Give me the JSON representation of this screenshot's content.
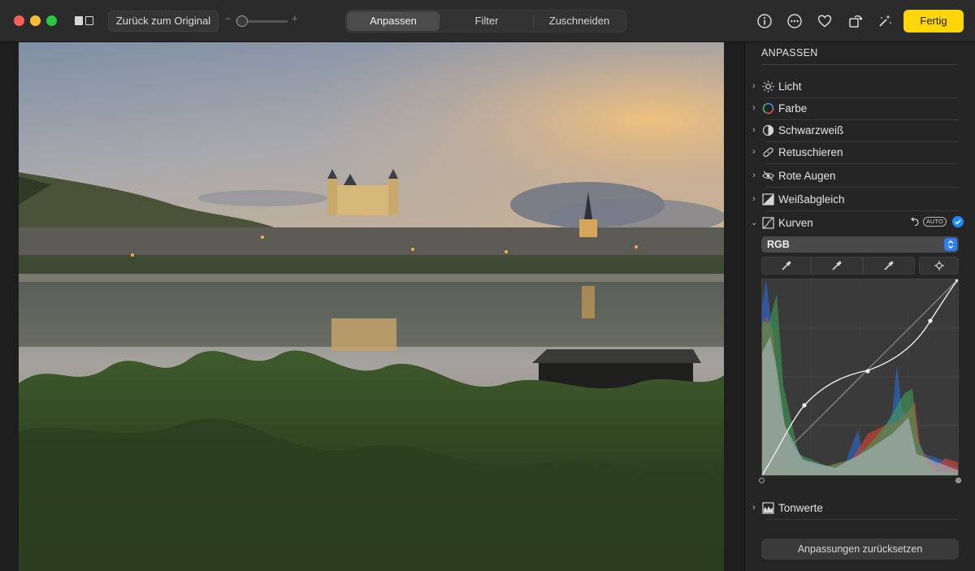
{
  "toolbar": {
    "revert_label": "Zurück zum Original",
    "zoom_minus": "−",
    "zoom_plus": "+",
    "zoom_level": 0.05,
    "tabs": [
      {
        "label": "Anpassen",
        "selected": true
      },
      {
        "label": "Filter",
        "selected": false
      },
      {
        "label": "Zuschneiden",
        "selected": false
      }
    ],
    "done_label": "Fertig",
    "icons": [
      "info-icon",
      "more-icon",
      "heart-icon",
      "rotate-icon",
      "magic-wand-icon"
    ],
    "accent": "#ffd60a"
  },
  "sidebar": {
    "title": "ANPASSEN",
    "items": [
      {
        "label": "Licht",
        "icon": "sun-icon"
      },
      {
        "label": "Farbe",
        "icon": "color-ring-icon"
      },
      {
        "label": "Schwarzweiß",
        "icon": "half-circle-icon"
      },
      {
        "label": "Retuschieren",
        "icon": "bandage-icon"
      },
      {
        "label": "Rote Augen",
        "icon": "eye-slash-icon"
      },
      {
        "label": "Weißabgleich",
        "icon": "white-balance-icon"
      }
    ],
    "curves": {
      "label": "Kurven",
      "expanded": true,
      "auto_label": "AUTO",
      "channel": "RGB",
      "check_color": "#1a8cff"
    },
    "levels": {
      "label": "Tonwerte",
      "icon": "levels-icon"
    },
    "reset_label": "Anpassungen zurücksetzen"
  }
}
